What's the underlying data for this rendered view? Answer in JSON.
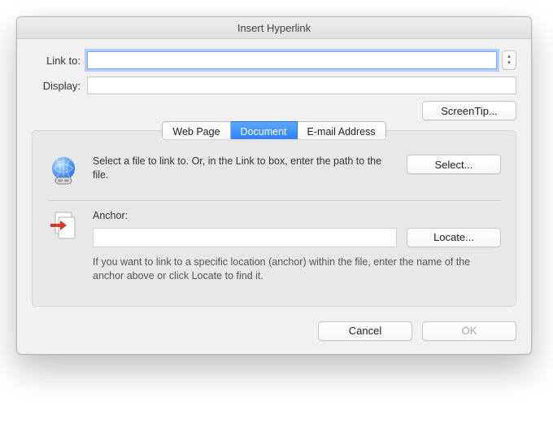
{
  "title": "Insert Hyperlink",
  "fields": {
    "link_to_label": "Link to:",
    "link_to_value": "",
    "display_label": "Display:",
    "display_value": ""
  },
  "buttons": {
    "screentip": "ScreenTip...",
    "select": "Select...",
    "locate": "Locate...",
    "cancel": "Cancel",
    "ok": "OK"
  },
  "tabs": {
    "web": "Web Page",
    "document": "Document",
    "email": "E-mail Address"
  },
  "panel": {
    "file_hint": "Select a file to link to. Or, in the Link to box, enter the path to the file.",
    "anchor_label": "Anchor:",
    "anchor_value": "",
    "anchor_hint": "If you want to link to a specific location (anchor) within the file, enter the name of the anchor above or click Locate to find it."
  }
}
